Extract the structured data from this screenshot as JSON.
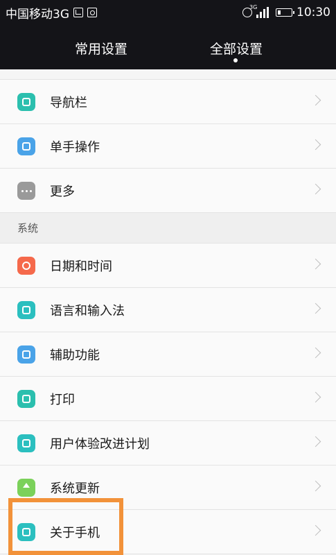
{
  "status_bar": {
    "carrier": "中国移动3G",
    "network_tag": "3G",
    "time": "10:30",
    "icons": [
      "image-icon",
      "camera-icon",
      "alarm-icon",
      "signal-icon",
      "battery-icon"
    ]
  },
  "tabs": {
    "common_label": "常用设置",
    "all_label": "全部设置",
    "active": "全部设置"
  },
  "list": {
    "top_items": [
      {
        "label": "导航栏",
        "icon": "navigation-bar-icon",
        "color": "#2bbfae"
      },
      {
        "label": "单手操作",
        "icon": "one-hand-icon",
        "color": "#4aa3e8"
      },
      {
        "label": "更多",
        "icon": "more-icon",
        "color": "#9a9a9a"
      }
    ],
    "section_title": "系统",
    "system_items": [
      {
        "label": "日期和时间",
        "icon": "clock-icon",
        "color": "#f5694b"
      },
      {
        "label": "语言和输入法",
        "icon": "language-icon",
        "color": "#2bbfbf"
      },
      {
        "label": "辅助功能",
        "icon": "accessibility-icon",
        "color": "#4aa3e8"
      },
      {
        "label": "打印",
        "icon": "printer-icon",
        "color": "#2bbfae"
      },
      {
        "label": "用户体验改进计划",
        "icon": "user-experience-icon",
        "color": "#2bbfbf"
      },
      {
        "label": "系统更新",
        "icon": "system-update-icon",
        "color": "#7bd15a"
      },
      {
        "label": "关于手机",
        "icon": "phone-icon",
        "color": "#2bbfbf"
      }
    ]
  },
  "highlight_color": "#f2923a"
}
